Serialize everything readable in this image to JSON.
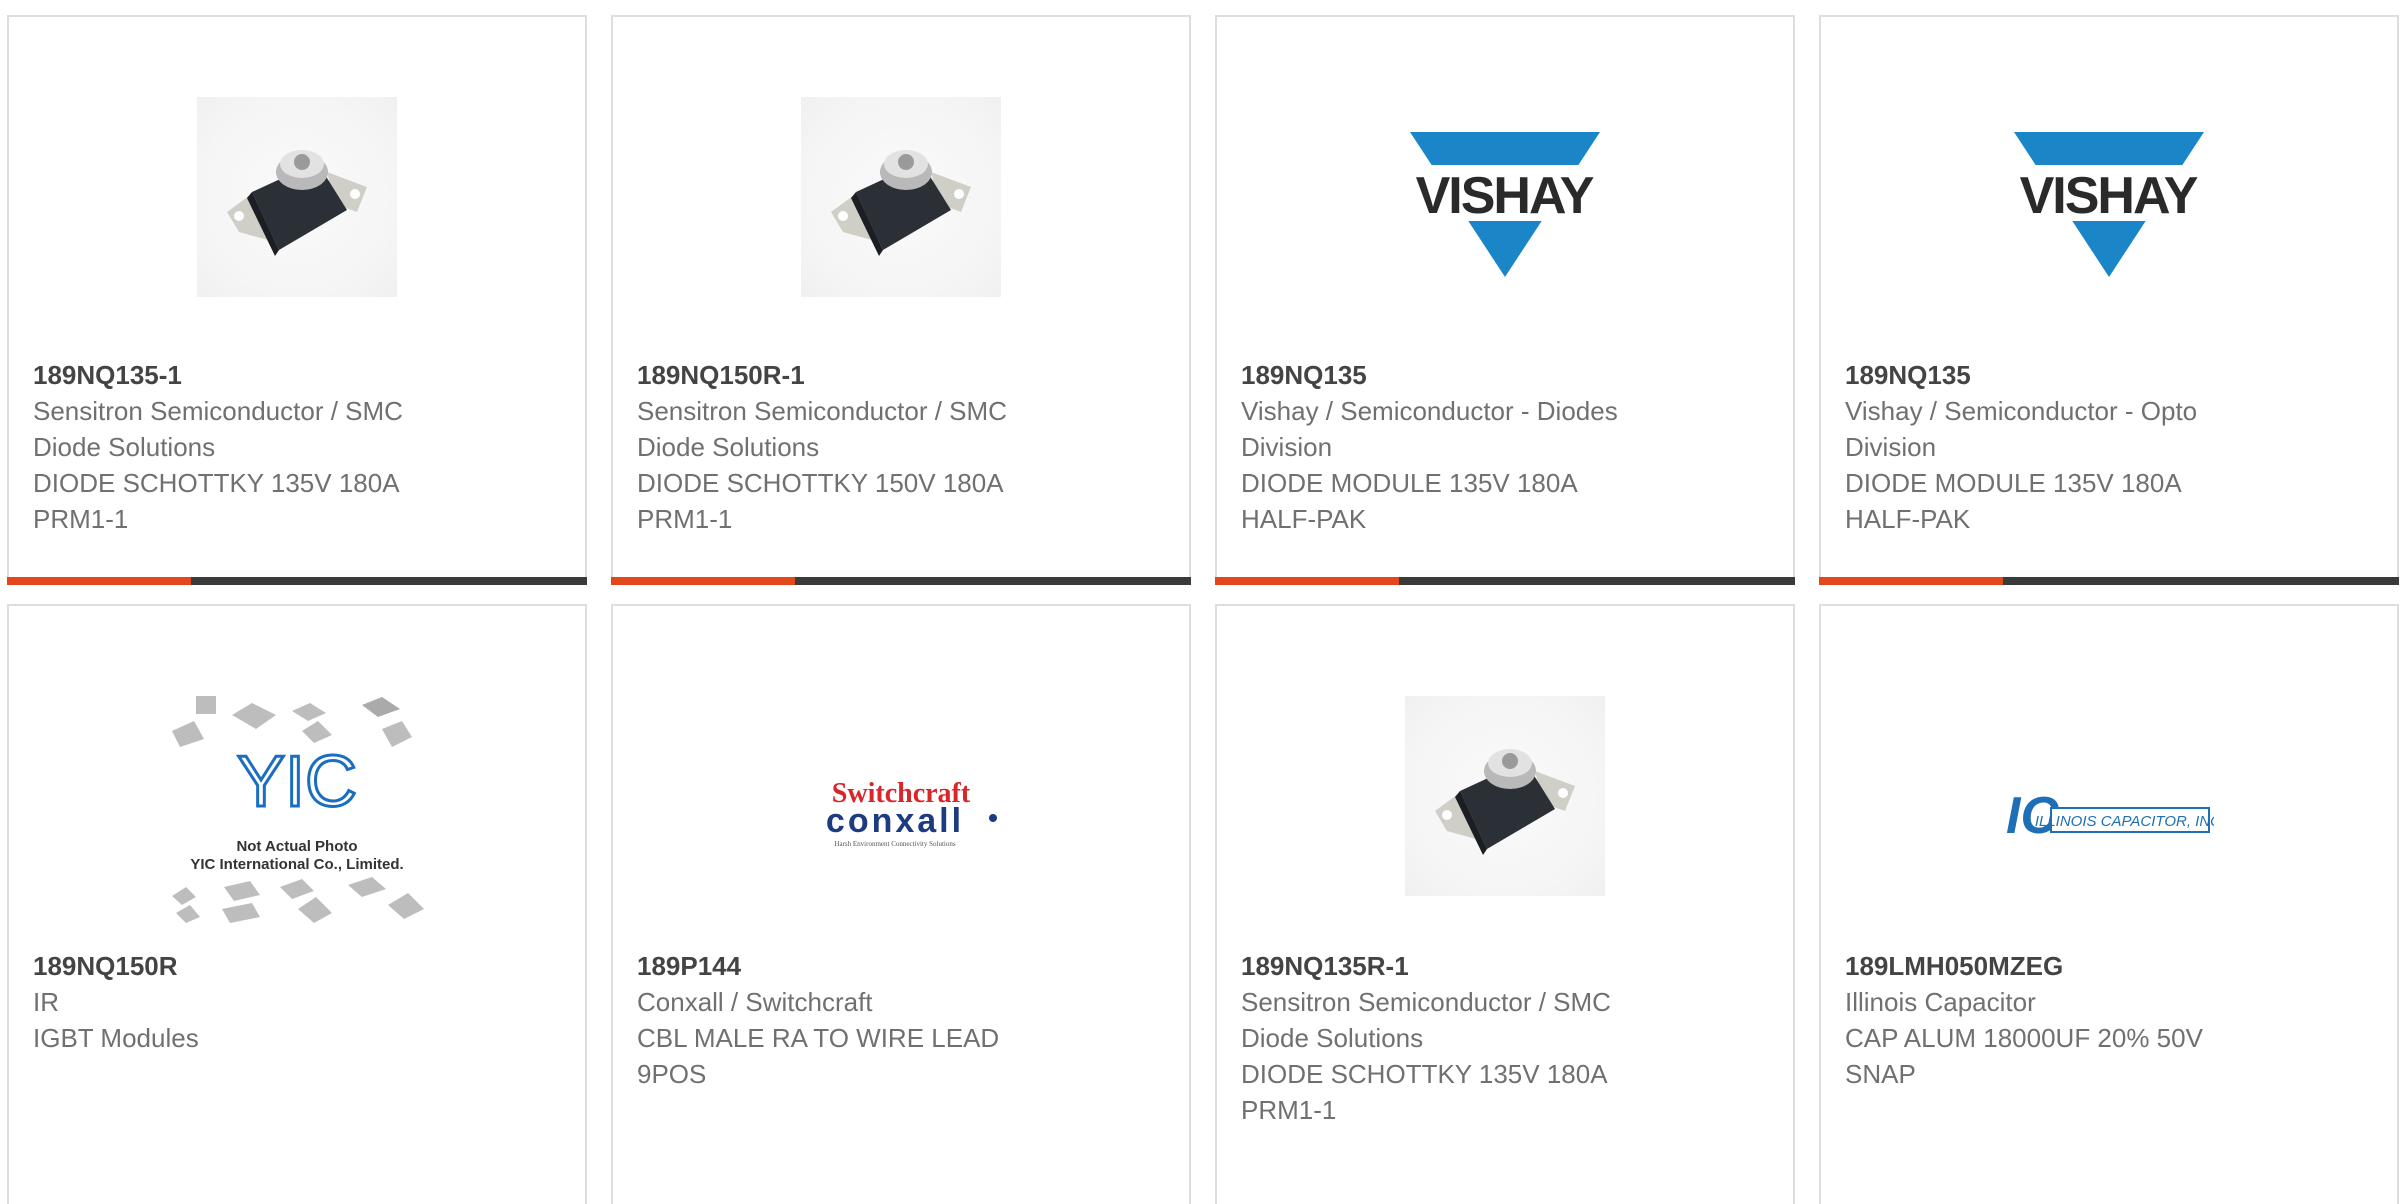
{
  "cards": [
    {
      "part": "189NQ135-1",
      "mfr_1": "Sensitron Semiconductor / SMC",
      "mfr_2": "Diode Solutions",
      "desc_1": "DIODE SCHOTTKY 135V 180A",
      "desc_2": "PRM1-1"
    },
    {
      "part": "189NQ150R-1",
      "mfr_1": "Sensitron Semiconductor / SMC",
      "mfr_2": "Diode Solutions",
      "desc_1": "DIODE SCHOTTKY 150V 180A",
      "desc_2": "PRM1-1"
    },
    {
      "part": "189NQ135",
      "mfr_1": "Vishay / Semiconductor - Diodes",
      "mfr_2": "Division",
      "desc_1": "DIODE MODULE 135V 180A",
      "desc_2": "HALF-PAK"
    },
    {
      "part": "189NQ135",
      "mfr_1": "Vishay / Semiconductor - Opto",
      "mfr_2": "Division",
      "desc_1": "DIODE MODULE 135V 180A",
      "desc_2": "HALF-PAK"
    },
    {
      "part": "189NQ150R",
      "mfr_1": "IR",
      "mfr_2": "IGBT Modules",
      "desc_1": "",
      "desc_2": ""
    },
    {
      "part": "189P144",
      "mfr_1": "Conxall / Switchcraft",
      "mfr_2": "CBL MALE RA TO WIRE LEAD",
      "desc_1": "9POS",
      "desc_2": ""
    },
    {
      "part": "189NQ135R-1",
      "mfr_1": "Sensitron Semiconductor / SMC",
      "mfr_2": "Diode Solutions",
      "desc_1": "DIODE SCHOTTKY 135V 180A",
      "desc_2": "PRM1-1"
    },
    {
      "part": "189LMH050MZEG",
      "mfr_1": "Illinois Capacitor",
      "mfr_2": "CAP ALUM 18000UF 20% 50V",
      "desc_1": "SNAP",
      "desc_2": ""
    }
  ],
  "logos": {
    "vishay": "VISHAY",
    "yic_mark": "YIC",
    "yic_line1": "Not Actual Photo",
    "yic_line2": "YIC International Co., Limited.",
    "switchcraft": "Switchcraft",
    "conxall": "conxall",
    "conxall_tag": "Harsh Environment Connectivity Solutions",
    "illinois_mark": "IC",
    "illinois_name": "ILLINOIS CAPACITOR, INC."
  },
  "colors": {
    "accent": "#e4471b",
    "bar": "#3a3a3a",
    "vishay_blue": "#1a86c8"
  }
}
